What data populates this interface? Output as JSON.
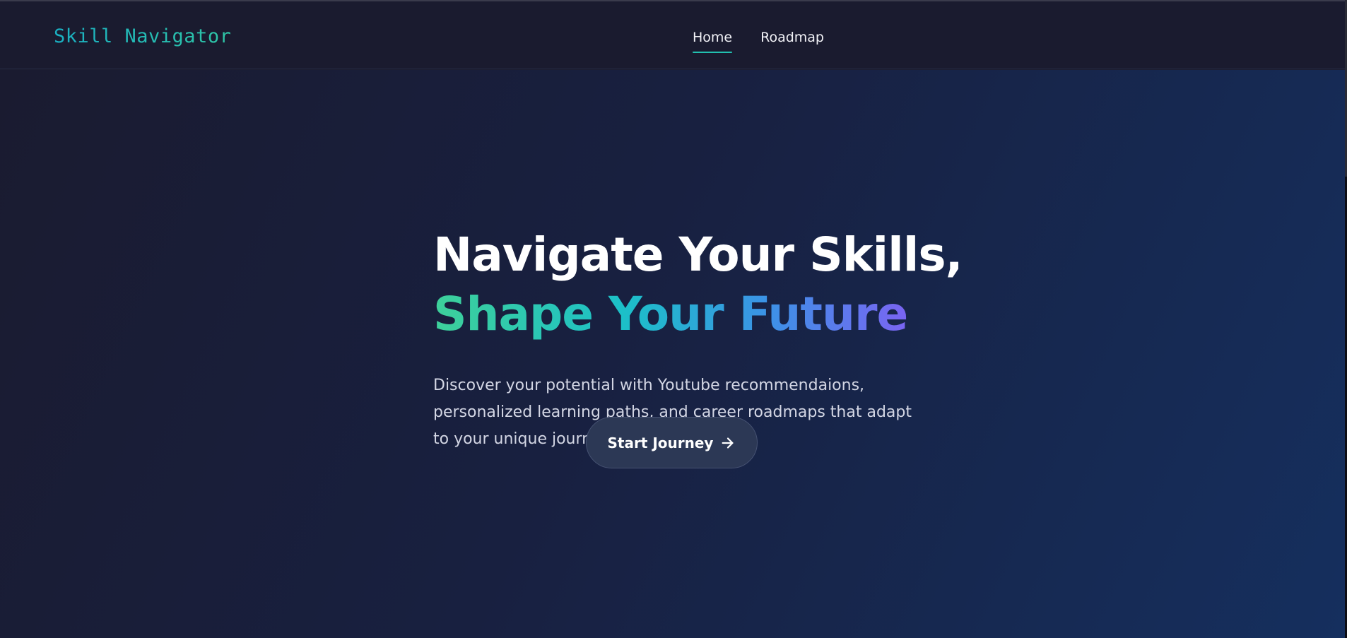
{
  "navbar": {
    "brand": "Skill Navigator",
    "links": [
      {
        "label": "Home",
        "active": true
      },
      {
        "label": "Roadmap",
        "active": false
      }
    ]
  },
  "hero": {
    "headline_line1": "Navigate Your Skills,",
    "headline_line2": "Shape Your Future",
    "description": "Discover your potential with Youtube recommendaions, personalized learning paths, and career roadmaps that adapt to your unique journey.",
    "cta_label": "Start Journey",
    "cta_icon": "arrow-right-icon"
  },
  "colors": {
    "accent_teal": "#22c0b0",
    "gradient_start": "#3ed09a",
    "gradient_end": "#7a64f2",
    "background": "#1a1b2f"
  }
}
